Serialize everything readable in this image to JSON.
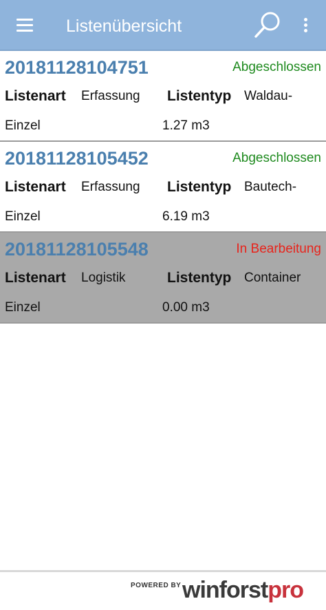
{
  "appbar": {
    "title": "Listenübersicht",
    "menu_icon": "hamburger-menu-icon",
    "search_icon": "search-icon",
    "more_icon": "more-vert-icon",
    "background_color": "#8fb4dc"
  },
  "labels": {
    "listenart": "Listenart",
    "listentyp": "Listentyp"
  },
  "lists": [
    {
      "id": "20181128104751",
      "status": "Abgeschlossen",
      "status_color": "#1e8a1e",
      "listenart": "Erfassung",
      "listentyp": "Waldau-",
      "listentyp_cont": "Einzel",
      "volume": "1.27 m3",
      "selected": false
    },
    {
      "id": "20181128105452",
      "status": "Abgeschlossen",
      "status_color": "#1e8a1e",
      "listenart": "Erfassung",
      "listentyp": "Bautech-",
      "listentyp_cont": "Einzel",
      "volume": "6.19 m3",
      "selected": false
    },
    {
      "id": "20181128105548",
      "status": "In Bearbeitung",
      "status_color": "#e8241c",
      "listenart": "Logistik",
      "listentyp": "Container",
      "listentyp_cont": "Einzel",
      "volume": "0.00 m3",
      "selected": true
    }
  ],
  "footer": {
    "powered_by": "POWERED BY",
    "brand_part1": "winforst",
    "brand_part2": "pro"
  }
}
